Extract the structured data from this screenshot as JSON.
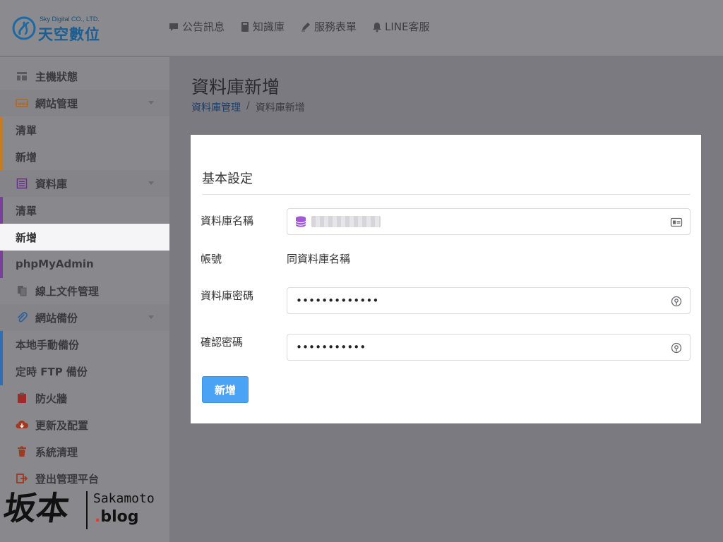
{
  "header": {
    "logo_en": "Sky Digital CO., LTD.",
    "logo_zh": "天空數位",
    "nav": [
      {
        "label": "公告訊息",
        "icon": "comment-icon"
      },
      {
        "label": "知識庫",
        "icon": "book-icon"
      },
      {
        "label": "服務表單",
        "icon": "pencil-icon"
      },
      {
        "label": "LINE客服",
        "icon": "bell-icon"
      }
    ]
  },
  "sidebar": {
    "items": [
      {
        "label": "主機狀態",
        "icon": "dashboard-icon"
      },
      {
        "label": "網站管理",
        "icon": "website-icon"
      },
      {
        "label": "清單"
      },
      {
        "label": "新增"
      },
      {
        "label": "資料庫",
        "icon": "list-icon"
      },
      {
        "label": "清單"
      },
      {
        "label": "新增"
      },
      {
        "label": "phpMyAdmin"
      },
      {
        "label": "線上文件管理",
        "icon": "files-icon"
      },
      {
        "label": "網站備份",
        "icon": "paperclip-icon"
      },
      {
        "label": "本地手動備份"
      },
      {
        "label": "定時 FTP 備份"
      },
      {
        "label": "防火牆",
        "icon": "clipboard-icon"
      },
      {
        "label": "更新及配置",
        "icon": "cloud-download-icon"
      },
      {
        "label": "系統清理",
        "icon": "trash-icon"
      },
      {
        "label": "登出管理平台",
        "icon": "logout-icon"
      }
    ]
  },
  "page": {
    "title": "資料庫新增",
    "breadcrumb": {
      "parent": "資料庫管理",
      "separator": "/",
      "current": "資料庫新增"
    }
  },
  "form": {
    "section_title": "基本設定",
    "db_name_label": "資料庫名稱",
    "account_label": "帳號",
    "account_value": "同資料庫名稱",
    "password_label": "資料庫密碼",
    "password_value": "•••••••••••••",
    "confirm_label": "確認密碼",
    "confirm_value": "•••••••••••",
    "submit_label": "新增"
  },
  "watermark": {
    "kanji": "坂本",
    "latin": "Sakamoto",
    "dot": ".",
    "blog": "blog"
  },
  "colors": {
    "accent": "#4aa3f5",
    "db_icon": "#a05ad8",
    "bar_website": "#c77a1e",
    "bar_database": "#7a3f9a",
    "bar_backup": "#2f6fb5"
  }
}
